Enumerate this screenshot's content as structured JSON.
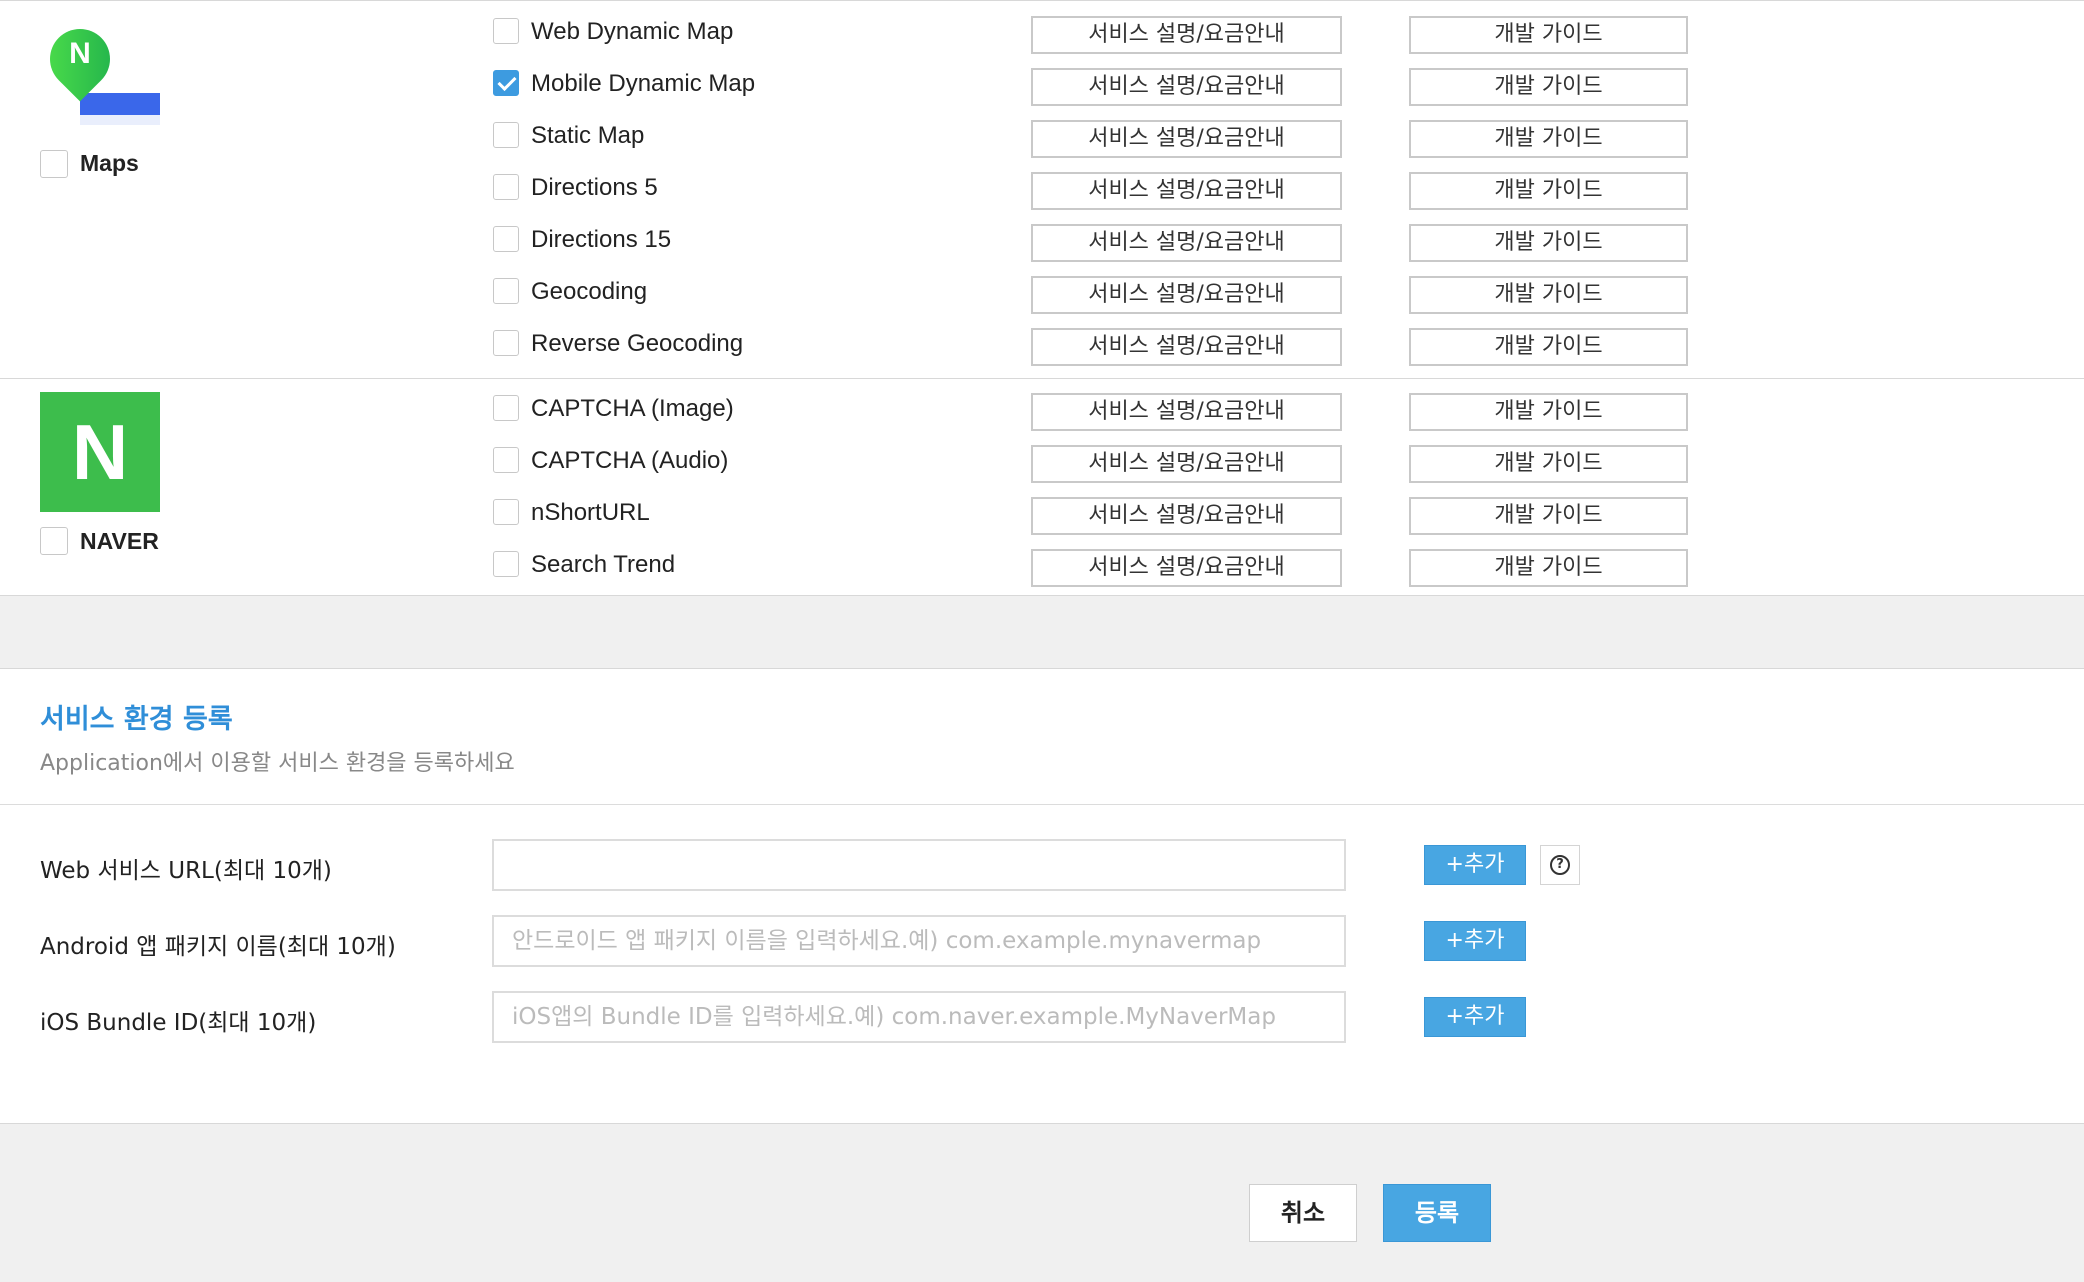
{
  "api_groups": [
    {
      "name": "Maps",
      "logo_letter": "N",
      "apis": [
        {
          "name": "Web Dynamic Map",
          "checked": false
        },
        {
          "name": "Mobile Dynamic Map",
          "checked": true
        },
        {
          "name": "Static Map",
          "checked": false
        },
        {
          "name": "Directions 5",
          "checked": false
        },
        {
          "name": "Directions 15",
          "checked": false
        },
        {
          "name": "Geocoding",
          "checked": false
        },
        {
          "name": "Reverse Geocoding",
          "checked": false
        }
      ]
    },
    {
      "name": "NAVER",
      "logo_letter": "N",
      "apis": [
        {
          "name": "CAPTCHA (Image)",
          "checked": false
        },
        {
          "name": "CAPTCHA (Audio)",
          "checked": false
        },
        {
          "name": "nShortURL",
          "checked": false
        },
        {
          "name": "Search Trend",
          "checked": false
        }
      ]
    }
  ],
  "row_buttons": {
    "service_desc": "서비스 설명/요금안내",
    "dev_guide": "개발 가이드"
  },
  "service_env": {
    "title": "서비스 환경 등록",
    "subtitle": "Application에서 이용할 서비스 환경을 등록하세요",
    "fields": [
      {
        "label": "Web 서비스 URL(최대 10개)",
        "value": "",
        "placeholder": "",
        "add_label": "+추가",
        "has_help": true,
        "help_icon": "?"
      },
      {
        "label": "Android 앱 패키지 이름(최대 10개)",
        "value": "",
        "placeholder": "안드로이드 앱 패키지 이름을 입력하세요.예) com.example.mynavermap",
        "add_label": "+추가",
        "has_help": false
      },
      {
        "label": "iOS Bundle ID(최대 10개)",
        "value": "",
        "placeholder": "iOS앱의 Bundle ID를 입력하세요.예) com.naver.example.MyNaverMap",
        "add_label": "+추가",
        "has_help": false
      }
    ]
  },
  "footer": {
    "cancel_label": "취소",
    "submit_label": "등록"
  },
  "colors": {
    "accent": "#48a6e2",
    "title_blue": "#2f8ed8",
    "naver_green": "#3dbd4c",
    "maps_blue": "#3a67ea"
  }
}
